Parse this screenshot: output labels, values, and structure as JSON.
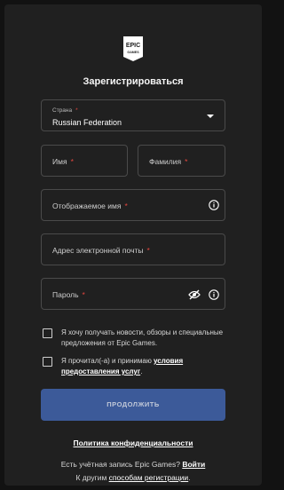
{
  "logo": {
    "line1": "EPIC",
    "line2": "GAMES"
  },
  "title": "Зарегистрироваться",
  "country": {
    "label": "Страна",
    "value": "Russian Federation"
  },
  "fields": {
    "first_name": "Имя",
    "last_name": "Фамилия",
    "display_name": "Отображаемое имя",
    "email": "Адрес электронной почты",
    "password": "Пароль"
  },
  "required_mark": "*",
  "checkboxes": {
    "news": "Я хочу получать новости, обзоры и специальные предложения от Epic Games.",
    "terms_prefix": "Я прочитал(-а) и принимаю ",
    "terms_link": "условия предоставления услуг",
    "terms_suffix": "."
  },
  "continue_button": "ПРОДОЛЖИТЬ",
  "footer": {
    "privacy": "Политика конфиденциальности",
    "have_account": "Есть учётная запись Epic Games? ",
    "login": "Войти",
    "other_prefix": "К другим ",
    "other_link": "способам регистрации",
    "other_suffix": "."
  },
  "colors": {
    "background": "#121212",
    "card": "#202020",
    "button": "#3c5a99",
    "required": "#e4463f"
  },
  "icons": [
    "epic-games-logo",
    "chevron-down-icon",
    "info-icon",
    "eye-hidden-icon"
  ]
}
